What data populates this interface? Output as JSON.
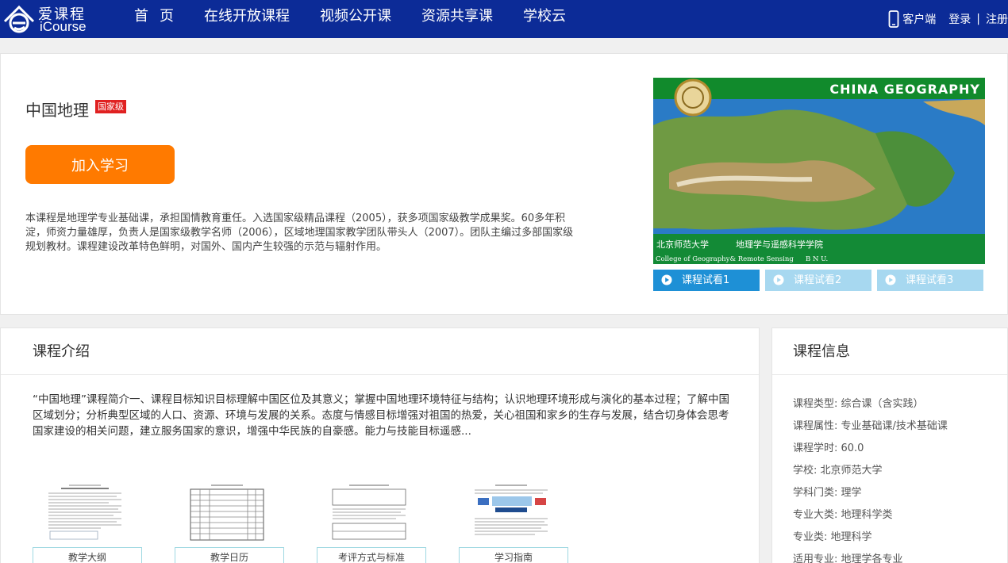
{
  "nav": {
    "logo_cn": "爱课程",
    "logo_en": "iCourse",
    "items": [
      "首页",
      "在线开放课程",
      "视频公开课",
      "资源共享课",
      "学校云"
    ],
    "client": "客户端",
    "login": "登录",
    "separator": "|",
    "register": "注册"
  },
  "course": {
    "title": "中国地理",
    "level": "国家级",
    "join_label": "加入学习",
    "description": "本课程是地理学专业基础课，承担国情教育重任。入选国家级精品课程（2005），获多项国家级教学成果奖。60多年积淀，师资力量雄厚，负责人是国家级教学名师（2006），区域地理国家教学团队带头人（2007）。团队主编过多部国家级规划教材。课程建设改革特色鲜明，对国外、国内产生较强的示范与辐射作用。",
    "cover": {
      "banner": "CHINA GEOGRAPHY",
      "school_cn": "北京师范大学",
      "dept_cn": "地理学与遥感科学学院",
      "dept_en": "College of Geography& Remote Sensing",
      "school_en": "B N U."
    },
    "trials": [
      "课程试看1",
      "课程试看2",
      "课程试看3"
    ]
  },
  "intro": {
    "heading": "课程介绍",
    "text": "“中国地理”课程简介一、课程目标知识目标理解中国区位及其意义；掌握中国地理环境特征与结构；认识地理环境形成与演化的基本过程；了解中国区域划分；分析典型区域的人口、资源、环境与发展的关系。态度与情感目标增强对祖国的热爱，关心祖国和家乡的生存与发展，结合切身体会思考国家建设的相关问题，建立服务国家的意识，增强中华民族的自豪感。能力与技能目标遥感...",
    "docs": [
      "教学大纲",
      "教学日历",
      "考评方式与标准",
      "学习指南"
    ]
  },
  "info": {
    "heading": "课程信息",
    "items": [
      "课程类型: 综合课（含实践）",
      "课程属性: 专业基础课/技术基础课",
      "课程学时: 60.0",
      "学校: 北京师范大学",
      "学科门类: 理学",
      "专业大类: 地理科学类",
      "专业类: 地理科学",
      "适用专业: 地理学各专业"
    ]
  },
  "colors": {
    "nav_bg": "#0c2b97",
    "join_button": "#ff7a00",
    "badge": "#e02121",
    "trial_active": "#1e90d6",
    "trial_inactive": "#a7d8f0"
  }
}
